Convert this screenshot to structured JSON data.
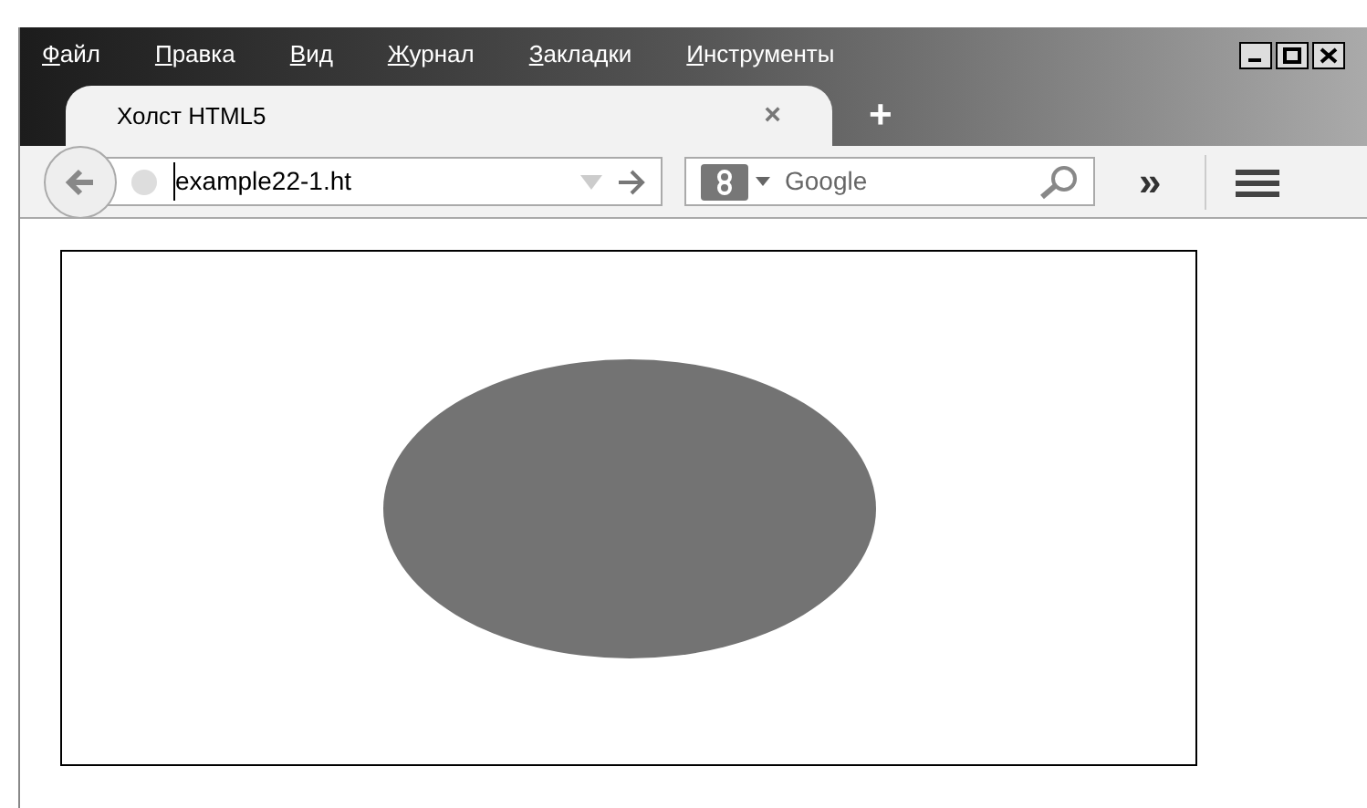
{
  "menu": [
    "Файл",
    "Правка",
    "Вид",
    "Журнал",
    "Закладки",
    "Инструменты"
  ],
  "tabs": [
    {
      "title": "Холст HTML5",
      "close": "×",
      "selected": true
    }
  ],
  "new_tab": "+",
  "address": {
    "value": "example22-1.ht"
  },
  "search": {
    "placeholder": "Google"
  },
  "overflow": "»"
}
